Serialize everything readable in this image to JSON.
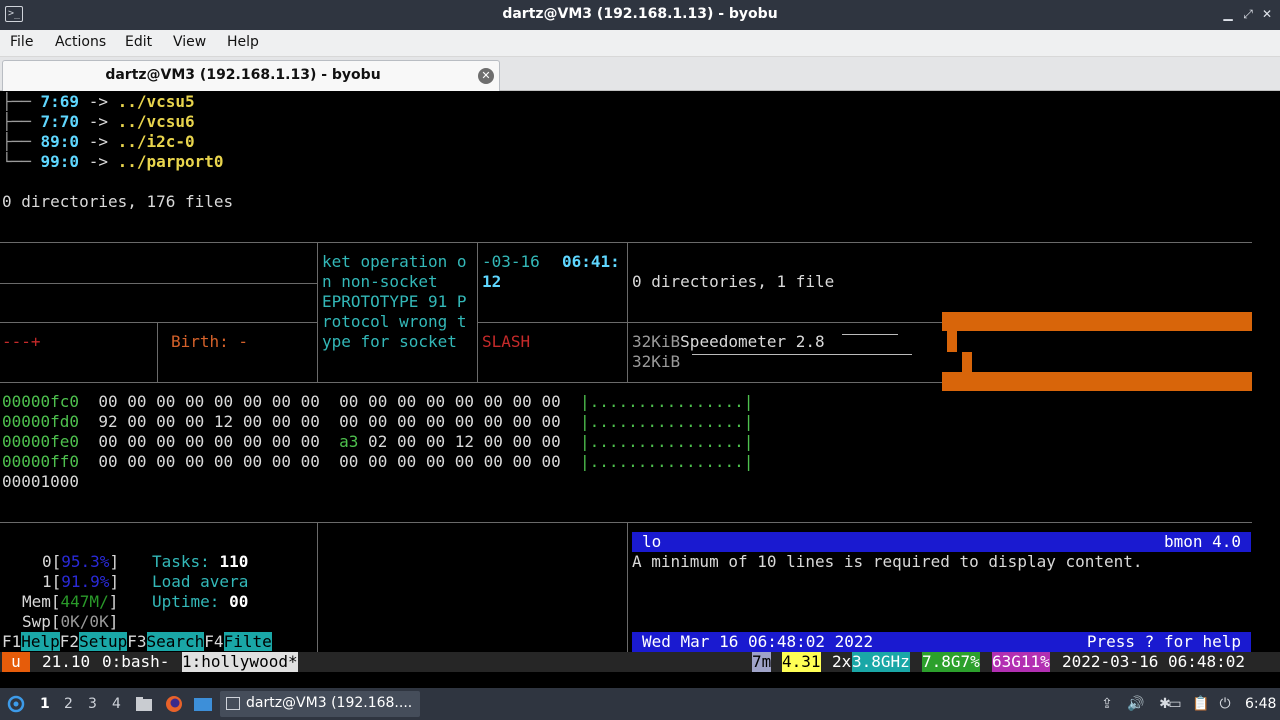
{
  "window": {
    "title": "dartz@VM3 (192.168.1.13) - byobu"
  },
  "menu": [
    "File",
    "Actions",
    "Edit",
    "View",
    "Help"
  ],
  "tab": {
    "label": "dartz@VM3 (192.168.1.13) - byobu"
  },
  "tree": {
    "lines": [
      {
        "branch": "├── ",
        "dev": "7:69",
        "arrow": " -> ",
        "target": "../vcsu5"
      },
      {
        "branch": "├── ",
        "dev": "7:70",
        "arrow": " -> ",
        "target": "../vcsu6"
      },
      {
        "branch": "├── ",
        "dev": "89:0",
        "arrow": " -> ",
        "target": "../i2c-0"
      },
      {
        "branch": "└── ",
        "dev": "99:0",
        "arrow": " -> ",
        "target": "../parport0"
      }
    ],
    "summary": "0 directories, 176 files"
  },
  "panes": {
    "perm": "---+",
    "birth": "Birth: -",
    "error_lines": [
      "ket operation o",
      "n non-socket",
      "EPROTOTYPE 91 P",
      "rotocol wrong t",
      "ype for socket"
    ],
    "date_fragment": "-03-16",
    "time_fragment": "06:41:",
    "time_fragment2": "12",
    "slash": "SLASH",
    "dir_summary": "0 directories, 1 file",
    "kib1": "32KiB",
    "speedometer": "Speedometer 2.8",
    "kib2": "32KiB"
  },
  "hexdump": {
    "rows": [
      {
        "addr": "00000fc0",
        "b1": "00 00 00 00 00 00 00 00",
        "b2a": "",
        "b2b": "00 00 00 00 00 00 00 00",
        "ascii": "|................|"
      },
      {
        "addr": "00000fd0",
        "b1": "92 00 00 00 12 00 00 00",
        "b2a": "",
        "b2b": "00 00 00 00 00 00 00 00",
        "ascii": "|................|"
      },
      {
        "addr": "00000fe0",
        "b1": "00 00 00 00 00 00 00 00",
        "b2a": "a3",
        "b2b": " 02 00 00 12 00 00 00",
        "ascii": "|................|"
      },
      {
        "addr": "00000ff0",
        "b1": "00 00 00 00 00 00 00 00",
        "b2a": "",
        "b2b": "00 00 00 00 00 00 00 00",
        "ascii": "|................|"
      }
    ],
    "end": "00001000"
  },
  "htop": {
    "cpu0_label": "0[",
    "cpu0_val": "95.3%",
    "cpu1_label": "1[",
    "cpu1_val": "91.9%",
    "mem_label": "Mem[",
    "mem_val": "447M/",
    "swp_label": "Swp[",
    "swp_val": "0K/0K",
    "close": "]",
    "tasks_label": "Tasks: ",
    "tasks_val": "110",
    "load_label": "Load avera",
    "uptime_label": "Uptime: ",
    "uptime_val": "00",
    "fkeys": [
      {
        "key": "F1",
        "label": "Help"
      },
      {
        "key": "F2",
        "label": "Setup"
      },
      {
        "key": "F3",
        "label": "Search"
      },
      {
        "key": "F4",
        "label": "Filte"
      }
    ]
  },
  "bmon": {
    "iface": "lo",
    "version": "bmon 4.0",
    "message": "A minimum of 10 lines is required to display content.",
    "datetime": "Wed Mar 16 06:48:02 2022",
    "help": "Press ? for help"
  },
  "byobu": {
    "logo": "u",
    "release": "21.10",
    "win0": "0:bash-",
    "win1": "1:hollywood*",
    "uptime": "7m",
    "load": "4.31",
    "cpu_count": "2x",
    "cpu_freq": "3.8GHz",
    "mem": "7.8G7%",
    "disk": "63G11%",
    "datetime": "2022-03-16 06:48:02"
  },
  "taskbar": {
    "workspaces": [
      "1",
      "2",
      "3",
      "4"
    ],
    "task_label": "dartz@VM3 (192.168....",
    "clock": "6:48"
  },
  "colors": {
    "titlebar": "#2f3540",
    "orange": "#d8650a",
    "bmon_bar": "#1a1ad0",
    "htop_fkey": "#1aa7a7"
  }
}
